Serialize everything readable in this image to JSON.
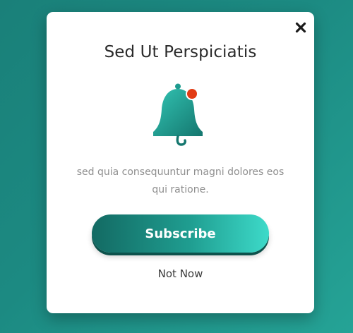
{
  "dialog": {
    "close_icon": "close-icon",
    "title": "Sed Ut Perspiciatis",
    "icon": "bell-notification-icon",
    "description": "sed quia consequuntur magni dolores eos qui ratione.",
    "subscribe_label": "Subscribe",
    "dismiss_label": "Not Now"
  },
  "colors": {
    "background": "#1c8a82",
    "accent": "#1f9d90",
    "accent_light": "#3ddac9",
    "accent_dark": "#136a63",
    "notification_dot": "#e23b14"
  }
}
